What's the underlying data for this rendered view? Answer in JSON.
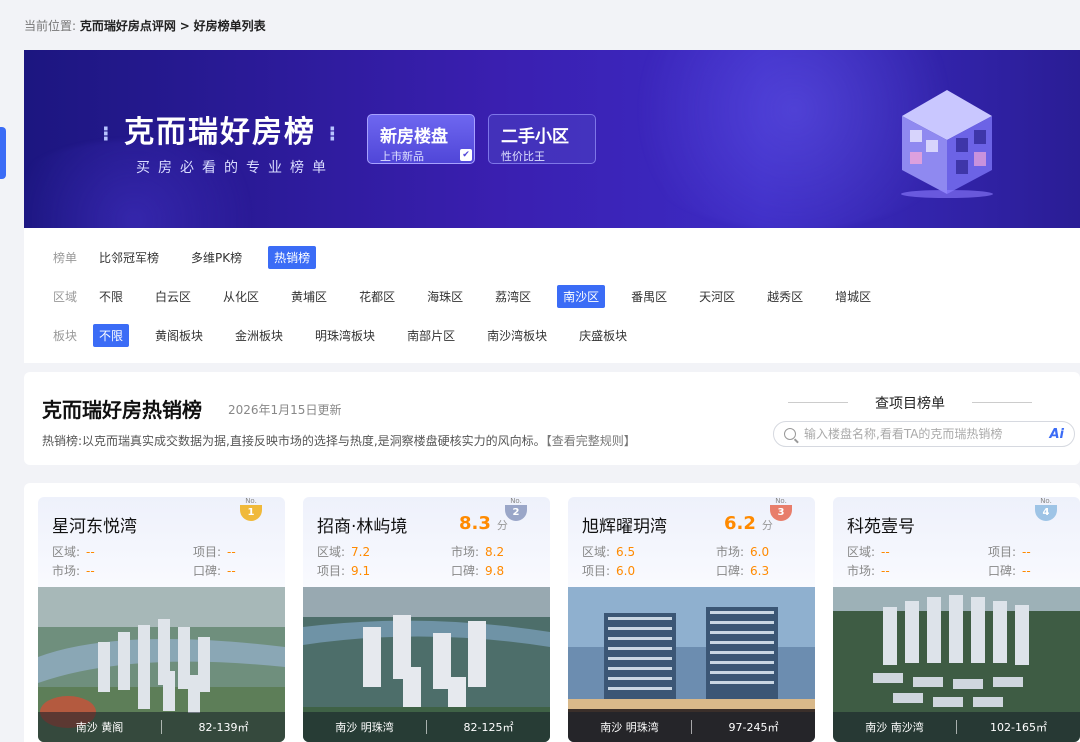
{
  "breadcrumb": {
    "label": "当前位置:",
    "site": "克而瑞好房点评网",
    "sep": ">",
    "page": "好房榜单列表"
  },
  "banner": {
    "title": "克而瑞好房榜",
    "title_dots_left": "⁝",
    "title_dots_right": "⁝",
    "subtitle": "买房必看的专业榜单",
    "buttons": [
      {
        "title": "新房楼盘",
        "sub": "上市新品",
        "active": true
      },
      {
        "title": "二手小区",
        "sub": "性价比王",
        "active": false
      }
    ]
  },
  "filters": {
    "list": {
      "label": "榜单",
      "options": [
        "比邻冠军榜",
        "多维PK榜",
        "热销榜"
      ],
      "selected": 2
    },
    "region": {
      "label": "区域",
      "options": [
        "不限",
        "白云区",
        "从化区",
        "黄埔区",
        "花都区",
        "海珠区",
        "荔湾区",
        "南沙区",
        "番禺区",
        "天河区",
        "越秀区",
        "增城区"
      ],
      "selected": 7
    },
    "block": {
      "label": "板块",
      "options": [
        "不限",
        "黄阁板块",
        "金洲板块",
        "明珠湾板块",
        "南部片区",
        "南沙湾板块",
        "庆盛板块"
      ],
      "selected": 0
    }
  },
  "ranking": {
    "title": "克而瑞好房热销榜",
    "updated": "2026年1月15日更新",
    "description": "热销榜:以克而瑞真实成交数据为据,直接反映市场的选择与热度,是洞察楼盘硬核实力的风向标。",
    "rules_link": "【查看完整规则】",
    "lookup_title": "查项目榜单",
    "search_placeholder": "输入楼盘名称,看看TA的克而瑞热销榜",
    "ai_label": "Ai"
  },
  "cards": [
    {
      "name": "星河东悦湾",
      "score": "",
      "unit": "",
      "rank": "1",
      "no": "No.",
      "labels": [
        "区域:",
        "项目:",
        "市场:",
        "口碑:"
      ],
      "values": [
        "--",
        "--",
        "--",
        "--"
      ],
      "area": "南沙 黄阁",
      "size": "82-139㎡",
      "medal_color": "#f0b93a"
    },
    {
      "name": "招商·林屿境",
      "score": "8.3",
      "unit": "分",
      "rank": "2",
      "no": "No.",
      "labels": [
        "区域:",
        "市场:",
        "项目:",
        "口碑:"
      ],
      "values": [
        "7.2",
        "8.2",
        "9.1",
        "9.8"
      ],
      "area": "南沙 明珠湾",
      "size": "82-125㎡",
      "medal_color": "#9aa6c8"
    },
    {
      "name": "旭辉曜玥湾",
      "score": "6.2",
      "unit": "分",
      "rank": "3",
      "no": "No.",
      "labels": [
        "区域:",
        "市场:",
        "项目:",
        "口碑:"
      ],
      "values": [
        "6.5",
        "6.0",
        "6.0",
        "6.3"
      ],
      "area": "南沙 明珠湾",
      "size": "97-245㎡",
      "medal_color": "#e87d6a"
    },
    {
      "name": "科苑壹号",
      "score": "",
      "unit": "",
      "rank": "4",
      "no": "No.",
      "labels": [
        "区域:",
        "项目:",
        "市场:",
        "口碑:"
      ],
      "values": [
        "--",
        "--",
        "--",
        "--"
      ],
      "area": "南沙 南沙湾",
      "size": "102-165㎡",
      "medal_color": "#9ec4e6"
    }
  ],
  "colors": {
    "accent": "#3b6cf6",
    "score": "#ff8a00",
    "banner": "#2a1d95"
  }
}
